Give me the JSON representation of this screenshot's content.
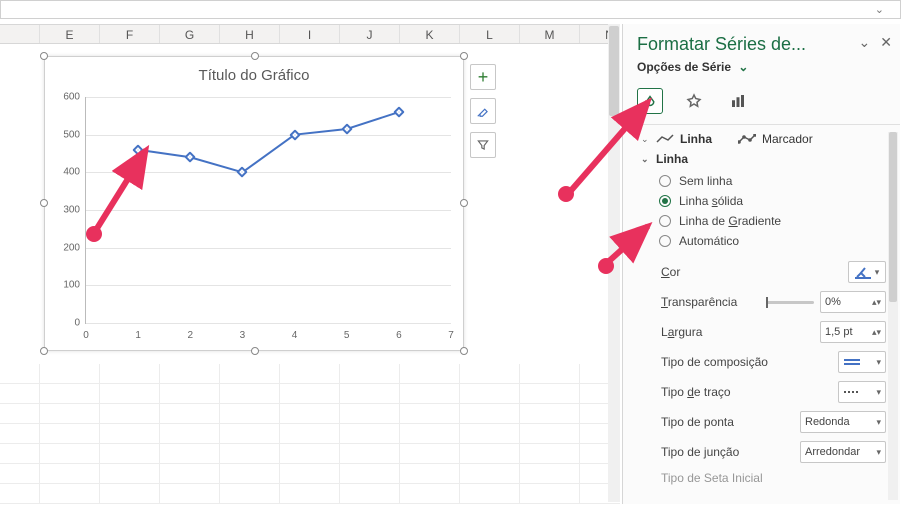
{
  "columns": [
    "",
    "E",
    "F",
    "G",
    "H",
    "I",
    "J",
    "K",
    "L",
    "M",
    "N"
  ],
  "chart_data": {
    "type": "line",
    "title": "Título do Gráfico",
    "xlabel": "",
    "ylabel": "",
    "x": [
      1,
      2,
      3,
      4,
      5,
      6
    ],
    "y": [
      460,
      440,
      400,
      500,
      515,
      560
    ],
    "xticks": [
      0,
      1,
      2,
      3,
      4,
      5,
      6,
      7
    ],
    "yticks": [
      0,
      100,
      200,
      300,
      400,
      500,
      600
    ],
    "ylim": [
      0,
      600
    ],
    "xlim": [
      0,
      7
    ]
  },
  "chart_widgets": {
    "add": "+",
    "style": "brush",
    "filter": "filter"
  },
  "pane": {
    "title": "Formatar Séries de...",
    "options_label": "Opções de Série",
    "tabs": {
      "fill": "Preenchimento e Linha",
      "effects": "Efeitos",
      "series": "Opções de Série"
    },
    "subtabs": {
      "linha": "Linha",
      "marcador": "Marcador"
    },
    "section_header": "Linha",
    "radios": [
      {
        "label": "Sem linha",
        "checked": false,
        "underline_char": null
      },
      {
        "label": "Linha sólida",
        "checked": true,
        "underline_char": "s"
      },
      {
        "label": "Linha de Gradiente",
        "checked": false,
        "underline_char": "G"
      },
      {
        "label": "Automático",
        "checked": false,
        "underline_char": null
      }
    ],
    "props": {
      "color": {
        "label": "Cor"
      },
      "transparency": {
        "label": "Transparência",
        "value": "0%"
      },
      "width": {
        "label": "Largura",
        "value": "1,5 pt"
      },
      "compound": {
        "label": "Tipo de composição"
      },
      "dash": {
        "label": "Tipo de traço"
      },
      "cap": {
        "label": "Tipo de ponta",
        "value": "Redonda"
      },
      "join": {
        "label": "Tipo de junção",
        "value": "Arredondar"
      },
      "arrow_begin": {
        "label": "Tipo de Seta Inicial"
      }
    }
  }
}
